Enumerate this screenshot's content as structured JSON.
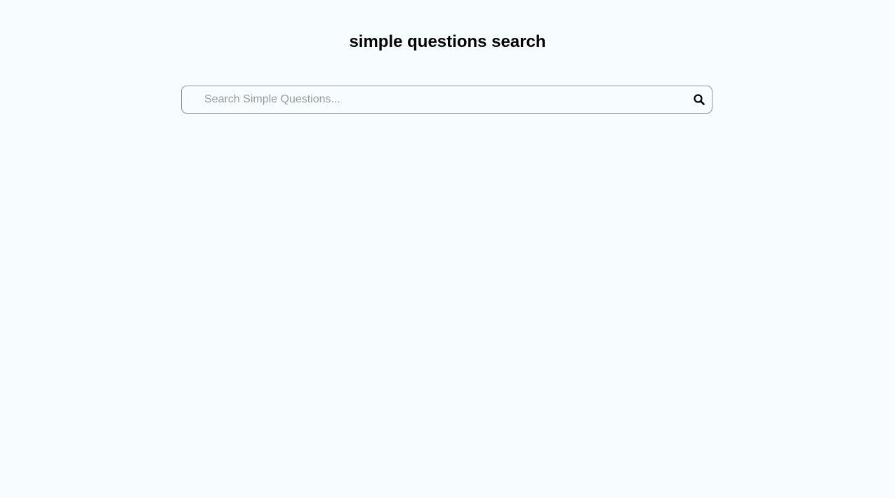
{
  "header": {
    "title": "simple questions search"
  },
  "search": {
    "placeholder": "Search Simple Questions...",
    "value": "",
    "icon": "search-icon"
  },
  "colors": {
    "background": "#f7fcff",
    "border": "#8e9399",
    "placeholder": "#9a9a9a"
  }
}
